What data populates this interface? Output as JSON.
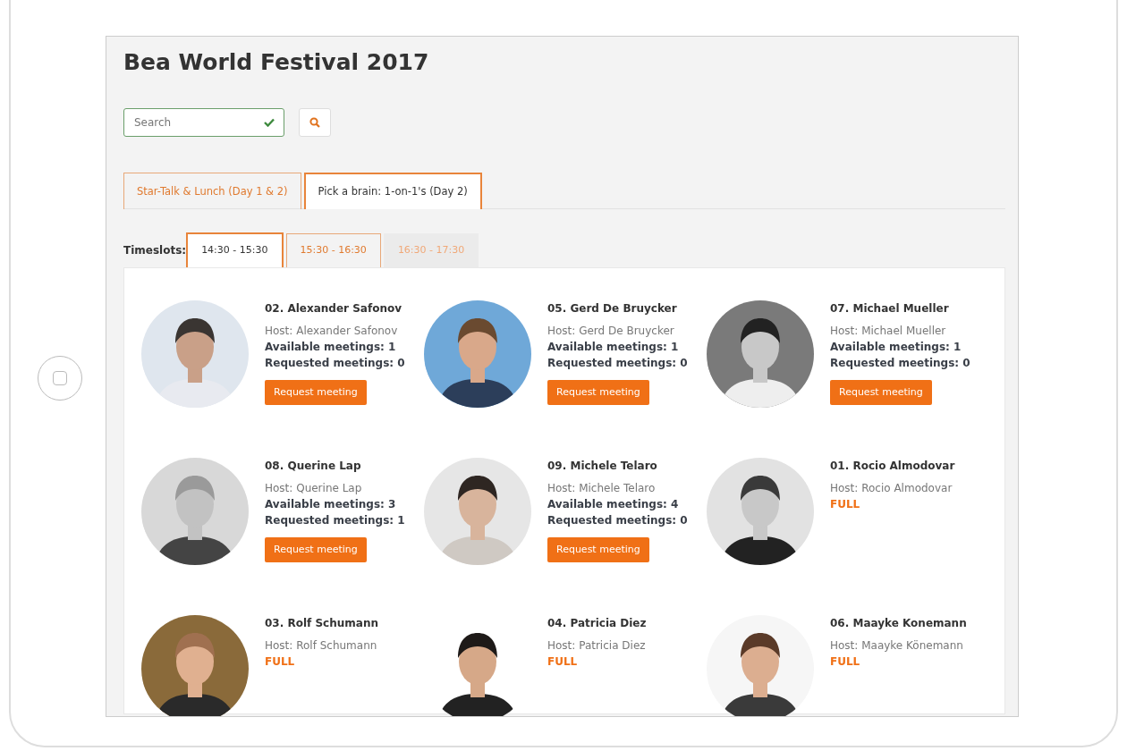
{
  "page": {
    "title": "Bea World Festival 2017"
  },
  "search": {
    "placeholder": "Search",
    "valid": true
  },
  "tabs": [
    {
      "label": "Star-Talk & Lunch (Day 1 & 2)",
      "selected": false
    },
    {
      "label": "Pick a brain: 1-on-1's (Day 2)",
      "selected": true
    }
  ],
  "timeslots": {
    "label": "Timeslots:",
    "items": [
      {
        "label": "14:30 - 15:30",
        "selected": true,
        "disabled": false
      },
      {
        "label": "15:30 - 16:30",
        "selected": false,
        "disabled": false
      },
      {
        "label": "16:30 - 17:30",
        "selected": false,
        "disabled": true
      }
    ]
  },
  "speakers": [
    {
      "kind": "open",
      "name": "02. Alexander Safonov",
      "host": "Host: Alexander Safonov",
      "available": "Available meetings: 1",
      "requested": "Requested meetings: 0",
      "button": "Request meeting"
    },
    {
      "kind": "open",
      "name": "05. Gerd De Bruycker",
      "host": "Host: Gerd De Bruycker",
      "available": "Available meetings: 1",
      "requested": "Requested meetings: 0",
      "button": "Request meeting"
    },
    {
      "kind": "open",
      "name": "07. Michael Mueller",
      "host": "Host: Michael Mueller",
      "available": "Available meetings: 1",
      "requested": "Requested meetings: 0",
      "button": "Request meeting"
    },
    {
      "kind": "open",
      "name": "08. Querine Lap",
      "host": "Host: Querine Lap",
      "available": "Available meetings: 3",
      "requested": "Requested meetings: 1",
      "button": "Request meeting"
    },
    {
      "kind": "open",
      "name": "09. Michele Telaro",
      "host": "Host: Michele Telaro",
      "available": "Available meetings: 4",
      "requested": "Requested meetings: 0",
      "button": "Request meeting"
    },
    {
      "kind": "full",
      "name": "01. Rocio Almodovar",
      "host": "Host: Rocio Almodovar",
      "status": "FULL"
    },
    {
      "kind": "full",
      "name": "03. Rolf Schumann",
      "host": "Host: Rolf Schumann",
      "status": "FULL"
    },
    {
      "kind": "full",
      "name": "04. Patricia Diez",
      "host": "Host: Patricia Diez",
      "status": "FULL"
    },
    {
      "kind": "full",
      "name": "06. Maayke Konemann",
      "host": "Host: Maayke Könemann",
      "status": "FULL"
    }
  ]
}
